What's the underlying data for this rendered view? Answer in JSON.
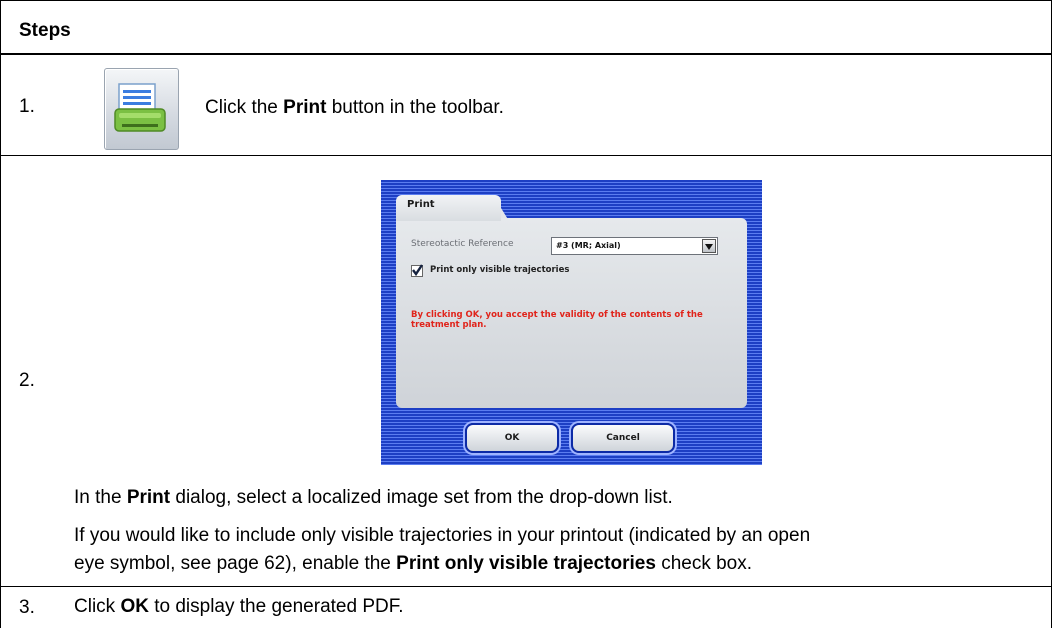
{
  "header": {
    "title": "Steps"
  },
  "steps": [
    {
      "number": "1.",
      "text": [
        "Click the ",
        "Print",
        " button in the toolbar."
      ],
      "icon": "printer-icon"
    },
    {
      "number": "2.",
      "dialog": {
        "tab_title": "Print",
        "stereo_label": "Stereotactic Reference",
        "stereo_value": "#3 (MR; Axial)",
        "checkbox_label": "Print only visible trajectories",
        "checkbox_checked": true,
        "warning_line1": "By clicking OK, you accept the validity of the contents of the",
        "warning_line2": "treatment plan.",
        "ok_label": "OK",
        "cancel_label": "Cancel"
      },
      "para1": [
        "In the ",
        "Print",
        " dialog, select a localized image set from the drop-down list."
      ],
      "para2_line1": "If you would like to include only visible trajectories in your printout (indicated by an open",
      "para2_line2": [
        "eye symbol, see page 62), enable the ",
        "Print only visible trajectories",
        " check box."
      ]
    },
    {
      "number": "3.",
      "text": [
        "Click ",
        "OK",
        " to display the generated PDF."
      ]
    }
  ],
  "colors": {
    "dialog_blue": "#1d3fc4",
    "warning_red": "#e0241b"
  }
}
